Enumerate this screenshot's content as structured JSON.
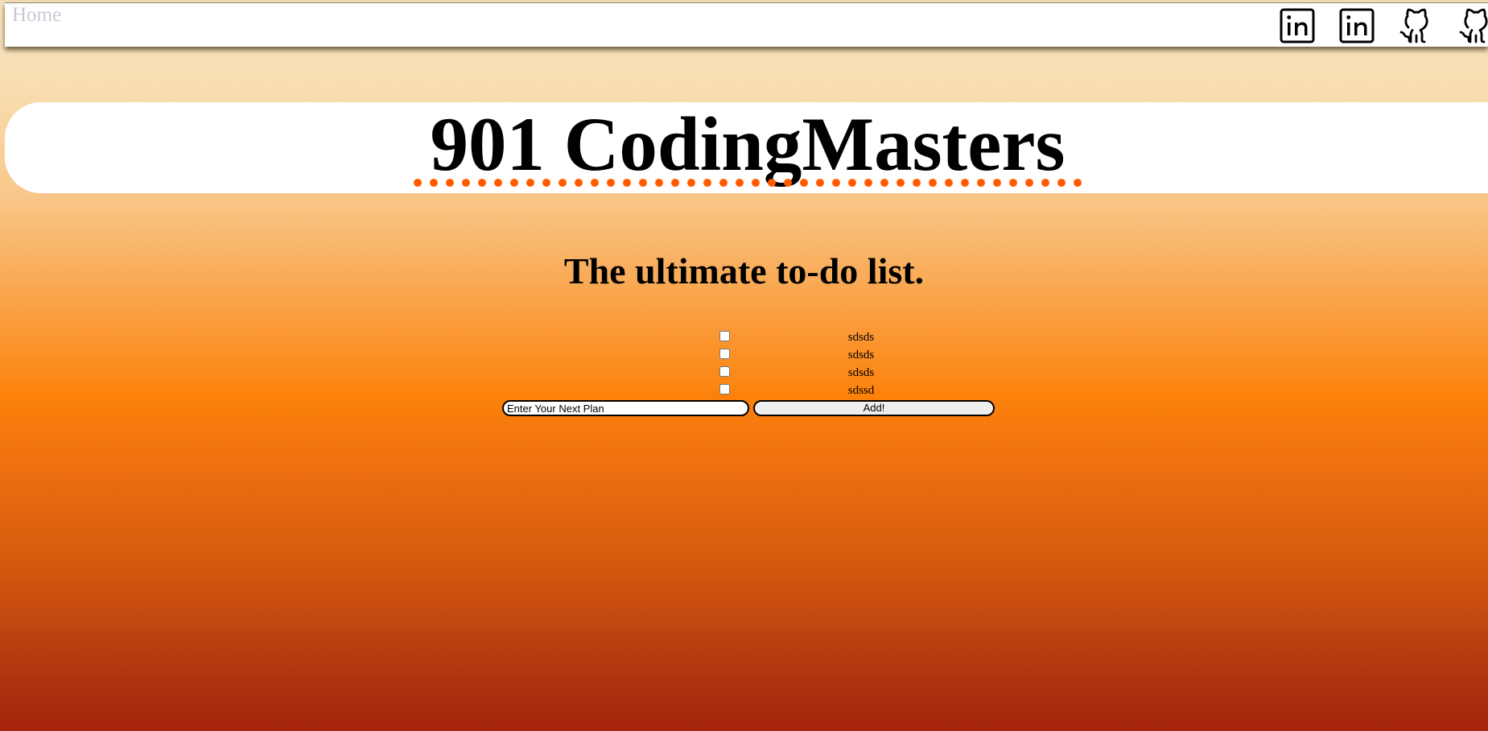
{
  "nav": {
    "home_label": "Home",
    "icons": [
      "linkedin-icon",
      "linkedin-icon",
      "github-icon",
      "github-icon"
    ]
  },
  "header": {
    "title": "901 CodingMasters",
    "underline_color": "#ff5a00"
  },
  "main": {
    "subtitle": "The ultimate to-do list.",
    "todos": [
      {
        "text": "sdsds",
        "checked": false
      },
      {
        "text": "sdsds",
        "checked": false
      },
      {
        "text": "sdsds",
        "checked": false
      },
      {
        "text": "sdssd",
        "checked": false
      }
    ],
    "input": {
      "value": "Enter Your Next Plan",
      "placeholder": ""
    },
    "add_button_label": "Add!"
  },
  "colors": {
    "background_top": "#f8e3bf",
    "background_middle": "#fc820b",
    "background_bottom": "#a4230c"
  }
}
